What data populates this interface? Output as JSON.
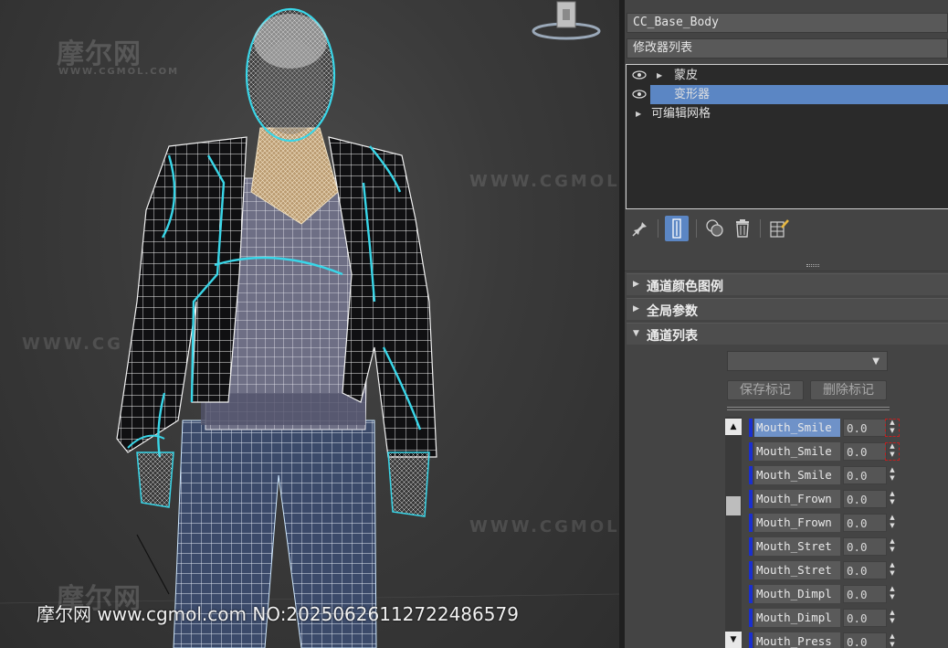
{
  "viewport": {
    "watermark_logo": "摩尔网",
    "watermark_small": "WWW.CGMOL.COM",
    "watermark_url": "WWW.CGMOL.COM",
    "watermark_url_partial": "WWW.CG",
    "caption": "摩尔网 www.cgmol.com NO:20250626112722486579"
  },
  "panel": {
    "object_name": "CC_Base_Body",
    "modifier_list": "修改器列表",
    "stack": [
      {
        "label": "蒙皮",
        "has_eye": true,
        "expandable": true,
        "selected": false
      },
      {
        "label": "变形器",
        "has_eye": true,
        "expandable": false,
        "selected": true
      },
      {
        "label": "可编辑网格",
        "has_eye": false,
        "expandable": true,
        "selected": false
      }
    ],
    "tools": [
      "pin-stack-icon",
      "show-end-result-icon",
      "make-unique-icon",
      "remove-modifier-icon",
      "configure-modifier-sets-icon"
    ],
    "rollouts": {
      "channel_color_legend": "通道颜色图例",
      "global_params": "全局参数",
      "channel_list": "通道列表"
    },
    "dropdown_value": "",
    "save_marker": "保存标记",
    "delete_marker": "删除标记",
    "channels": [
      {
        "name": "Mouth_Smile",
        "value": "0.0"
      },
      {
        "name": "Mouth_Smile",
        "value": "0.0"
      },
      {
        "name": "Mouth_Smile",
        "value": "0.0"
      },
      {
        "name": "Mouth_Frown",
        "value": "0.0"
      },
      {
        "name": "Mouth_Frown",
        "value": "0.0"
      },
      {
        "name": "Mouth_Stret",
        "value": "0.0"
      },
      {
        "name": "Mouth_Stret",
        "value": "0.0"
      },
      {
        "name": "Mouth_Dimpl",
        "value": "0.0"
      },
      {
        "name": "Mouth_Dimpl",
        "value": "0.0"
      },
      {
        "name": "Mouth_Press",
        "value": "0.0"
      }
    ],
    "colors": {
      "selection": "#5b86c4",
      "channel_strip": "#1a2fd0",
      "wire_highlight": "#39d6e8"
    }
  }
}
